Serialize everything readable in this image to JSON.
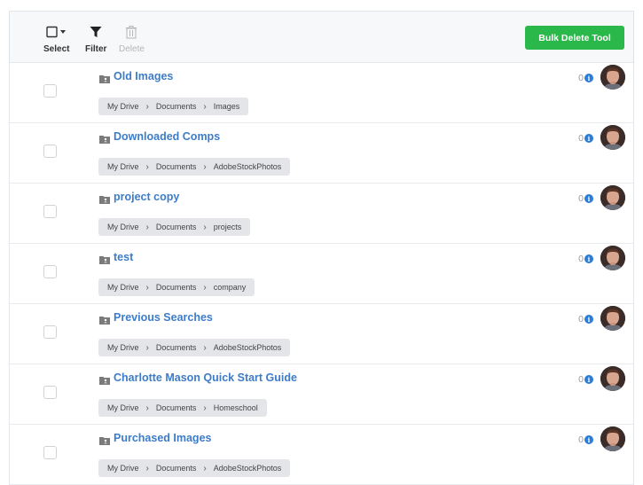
{
  "toolbar": {
    "select_label": "Select",
    "filter_label": "Filter",
    "delete_label": "Delete",
    "bulk_delete_label": "Bulk Delete Tool",
    "bulk_delete_color": "#2bb84a"
  },
  "accent_color": "#3d7cc9",
  "rows": [
    {
      "title": "Old Images",
      "path": [
        "My Drive",
        "Documents",
        "Images"
      ],
      "count": "0"
    },
    {
      "title": "Downloaded Comps",
      "path": [
        "My Drive",
        "Documents",
        "AdobeStockPhotos"
      ],
      "count": "0"
    },
    {
      "title": "project copy",
      "path": [
        "My Drive",
        "Documents",
        "projects"
      ],
      "count": "0"
    },
    {
      "title": "test",
      "path": [
        "My Drive",
        "Documents",
        "company"
      ],
      "count": "0"
    },
    {
      "title": "Previous Searches",
      "path": [
        "My Drive",
        "Documents",
        "AdobeStockPhotos"
      ],
      "count": "0"
    },
    {
      "title": "Charlotte Mason Quick Start Guide",
      "path": [
        "My Drive",
        "Documents",
        "Homeschool"
      ],
      "count": "0"
    },
    {
      "title": "Purchased Images",
      "path": [
        "My Drive",
        "Documents",
        "AdobeStockPhotos"
      ],
      "count": "0"
    }
  ],
  "icons": {
    "select": "checkbox-dropdown-icon",
    "filter": "funnel-icon",
    "delete": "trash-icon",
    "folder": "shared-folder-icon",
    "info": "info-icon",
    "avatar": "user-avatar"
  }
}
